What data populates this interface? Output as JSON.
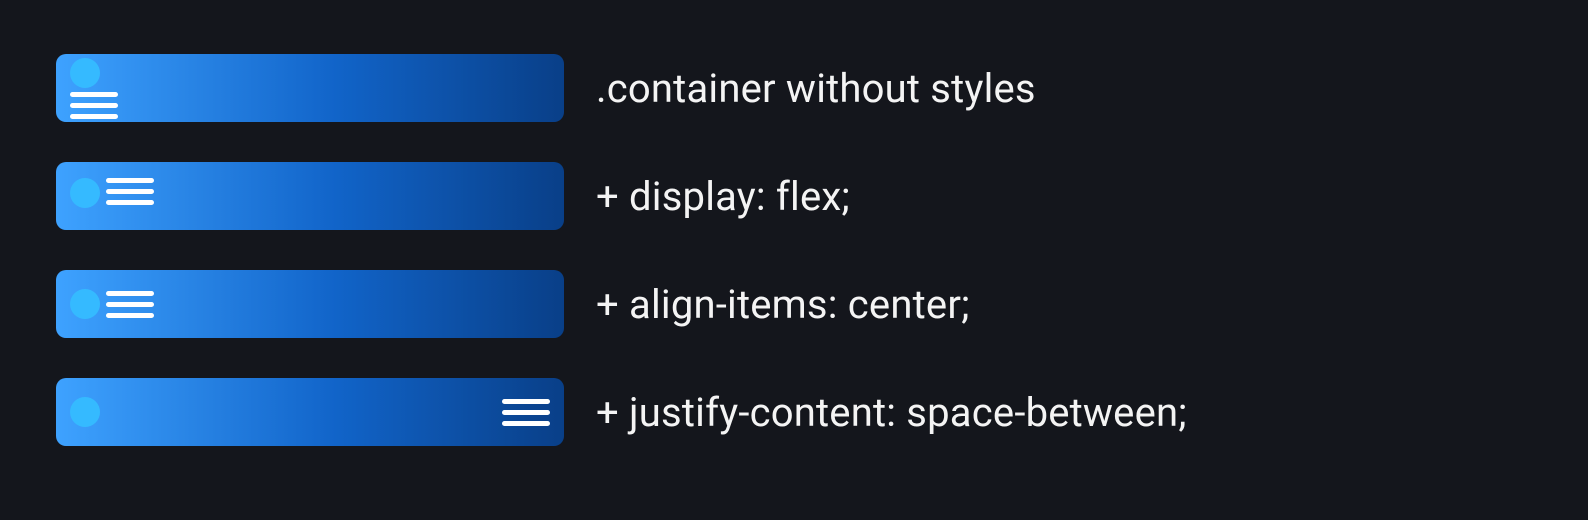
{
  "rows": [
    {
      "label": ".container without styles"
    },
    {
      "label": "+ display: flex;"
    },
    {
      "label": "+ align-items: center;"
    },
    {
      "label": "+ justify-content: space-between;"
    }
  ]
}
